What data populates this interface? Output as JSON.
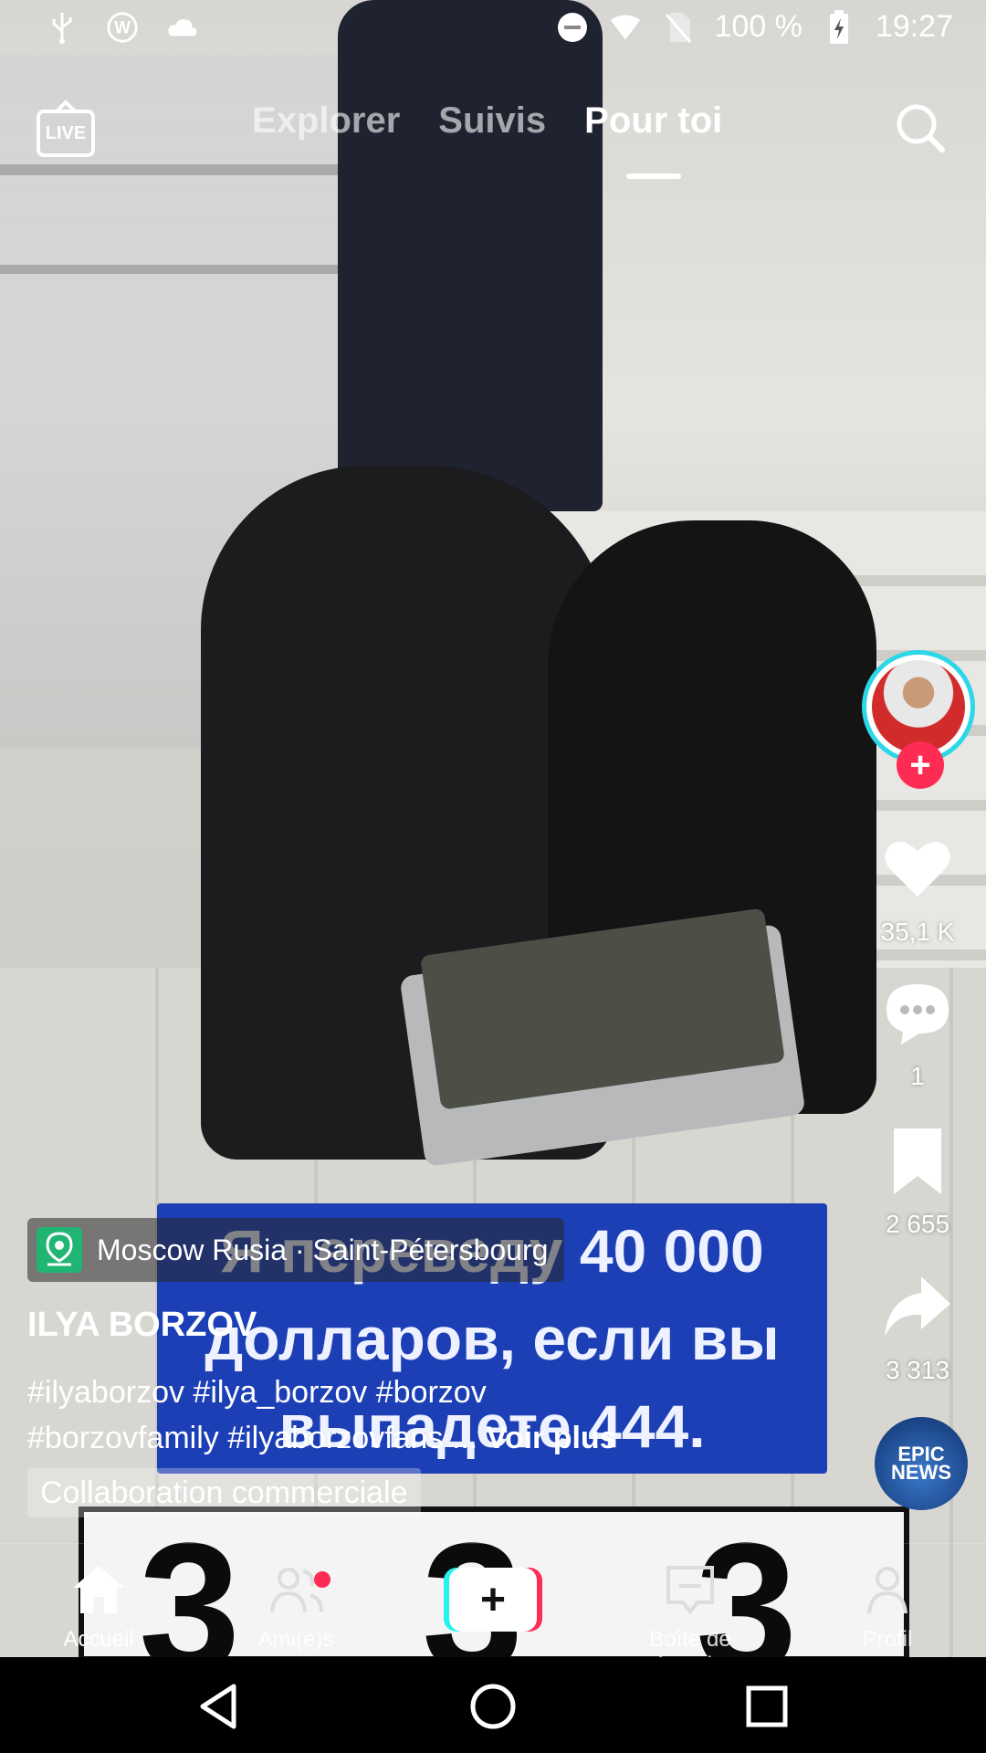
{
  "status_bar": {
    "battery": "100 %",
    "time": "19:27",
    "left_icons": [
      "usb-icon",
      "wordpress-icon",
      "cloud-icon"
    ],
    "right_icons": [
      "do-not-disturb-icon",
      "wifi-icon",
      "no-sim-icon",
      "battery-charging-icon"
    ]
  },
  "top_nav": {
    "live_label": "LIVE",
    "tabs": [
      {
        "label": "Explorer"
      },
      {
        "label": "Suivis"
      },
      {
        "label": "Pour toi"
      }
    ],
    "active_tab": "Pour toi"
  },
  "video_overlay": {
    "caption": "Я переведу 40 000 долларов, если вы выпадете 444.",
    "digits": [
      "3",
      "3",
      "3"
    ]
  },
  "right_rail": {
    "follow_plus": "+",
    "likes": "35,1 K",
    "comments": "1",
    "saves": "2 655",
    "shares": "3 313",
    "music_disc_text": [
      "EPIC",
      "NEWS"
    ]
  },
  "post": {
    "location": "Moscow Rusia · Saint-Pétersbourg",
    "author": "ILYA BORZOV",
    "description_line1": "#ilyaborzov #ilya_borzov #borzov",
    "description_line2": "#borzovfamily #ilyaborzovfans ...",
    "see_more": "Voir plus",
    "collab_label": "Collaboration commerciale"
  },
  "tab_bar": {
    "items": [
      {
        "label": "Accueil"
      },
      {
        "label": "Ami(e)s"
      },
      {
        "label": "Boîte de récepti…"
      },
      {
        "label": "Profil"
      }
    ],
    "create_label": "+"
  },
  "colors": {
    "accent_red": "#fe2c55",
    "accent_cyan": "#25f4ee",
    "caption_blue": "#1c3fb6",
    "location_green": "#21b573"
  }
}
